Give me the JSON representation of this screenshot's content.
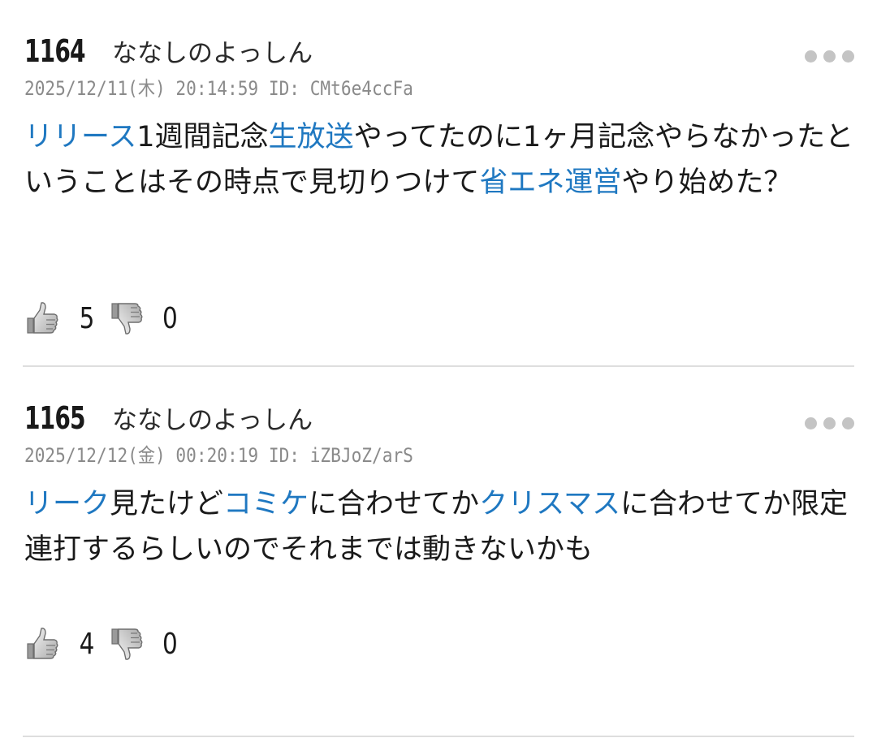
{
  "posts": [
    {
      "number": "1164",
      "name": "ななしのよっしん",
      "meta": "2025/12/11(木) 20:14:59 ID: CMt6e4ccFa",
      "segments": [
        {
          "text": "リリース",
          "link": true
        },
        {
          "text": "1週間記念",
          "link": false
        },
        {
          "text": "生放送",
          "link": true
        },
        {
          "text": "やってたのに1ヶ月記念やらなかったということはその時点で見切りつけて",
          "link": false
        },
        {
          "text": "省エネ運営",
          "link": true
        },
        {
          "text": "やり始めた？",
          "link": false
        }
      ],
      "likes": "5",
      "dislikes": "0"
    },
    {
      "number": "1165",
      "name": "ななしのよっしん",
      "meta": "2025/12/12(金) 00:20:19 ID: iZBJoZ/arS",
      "segments": [
        {
          "text": "リーク",
          "link": true
        },
        {
          "text": "見たけど",
          "link": false
        },
        {
          "text": "コミケ",
          "link": true
        },
        {
          "text": "に合わせてか",
          "link": false
        },
        {
          "text": "クリスマス",
          "link": true
        },
        {
          "text": "に合わせてか限定連打するらしいのでそれまでは動きないかも",
          "link": false
        }
      ],
      "likes": "4",
      "dislikes": "0"
    }
  ],
  "colors": {
    "link": "#1f78c1",
    "meta": "#8a8a8a",
    "divider": "#dedede",
    "dots": "#c4c4c4"
  },
  "icons": {
    "more": "more-dots-icon",
    "like": "thumbs-up-icon",
    "dislike": "thumbs-down-icon"
  }
}
